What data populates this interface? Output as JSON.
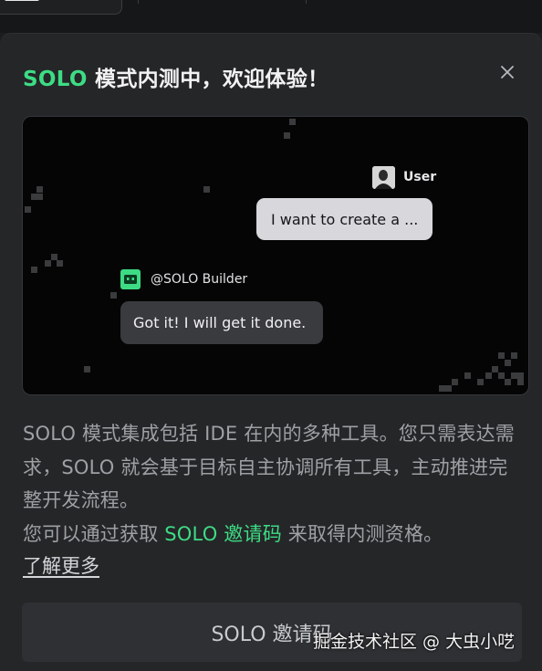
{
  "modal": {
    "title_accent": "SOLO",
    "title_rest": " 模式内测中，欢迎体验！"
  },
  "preview": {
    "user_name": "User",
    "user_message": "I want to create a ...",
    "bot_name": "@SOLO Builder",
    "bot_message": "Got it! I will get it done."
  },
  "description": {
    "line1": "SOLO 模式集成包括 IDE 在内的多种工具。您只需表达需求，SOLO 就会基于目标自主协调所有工具，主动推进完整开发流程。",
    "line2_before": "您可以通过获取 ",
    "line2_link": "SOLO 邀请码",
    "line2_after": " 来取得内测资格。"
  },
  "learn_more": "了解更多",
  "invite_button": "SOLO 邀请码",
  "watermark": "掘金技术社区 @ 大虫小呓",
  "colors": {
    "accent": "#3ddc84",
    "modal_bg": "#252628",
    "preview_bg": "#050505"
  },
  "icons": {
    "close": "close-icon",
    "bot": "bot-icon",
    "user_avatar": "avatar"
  }
}
